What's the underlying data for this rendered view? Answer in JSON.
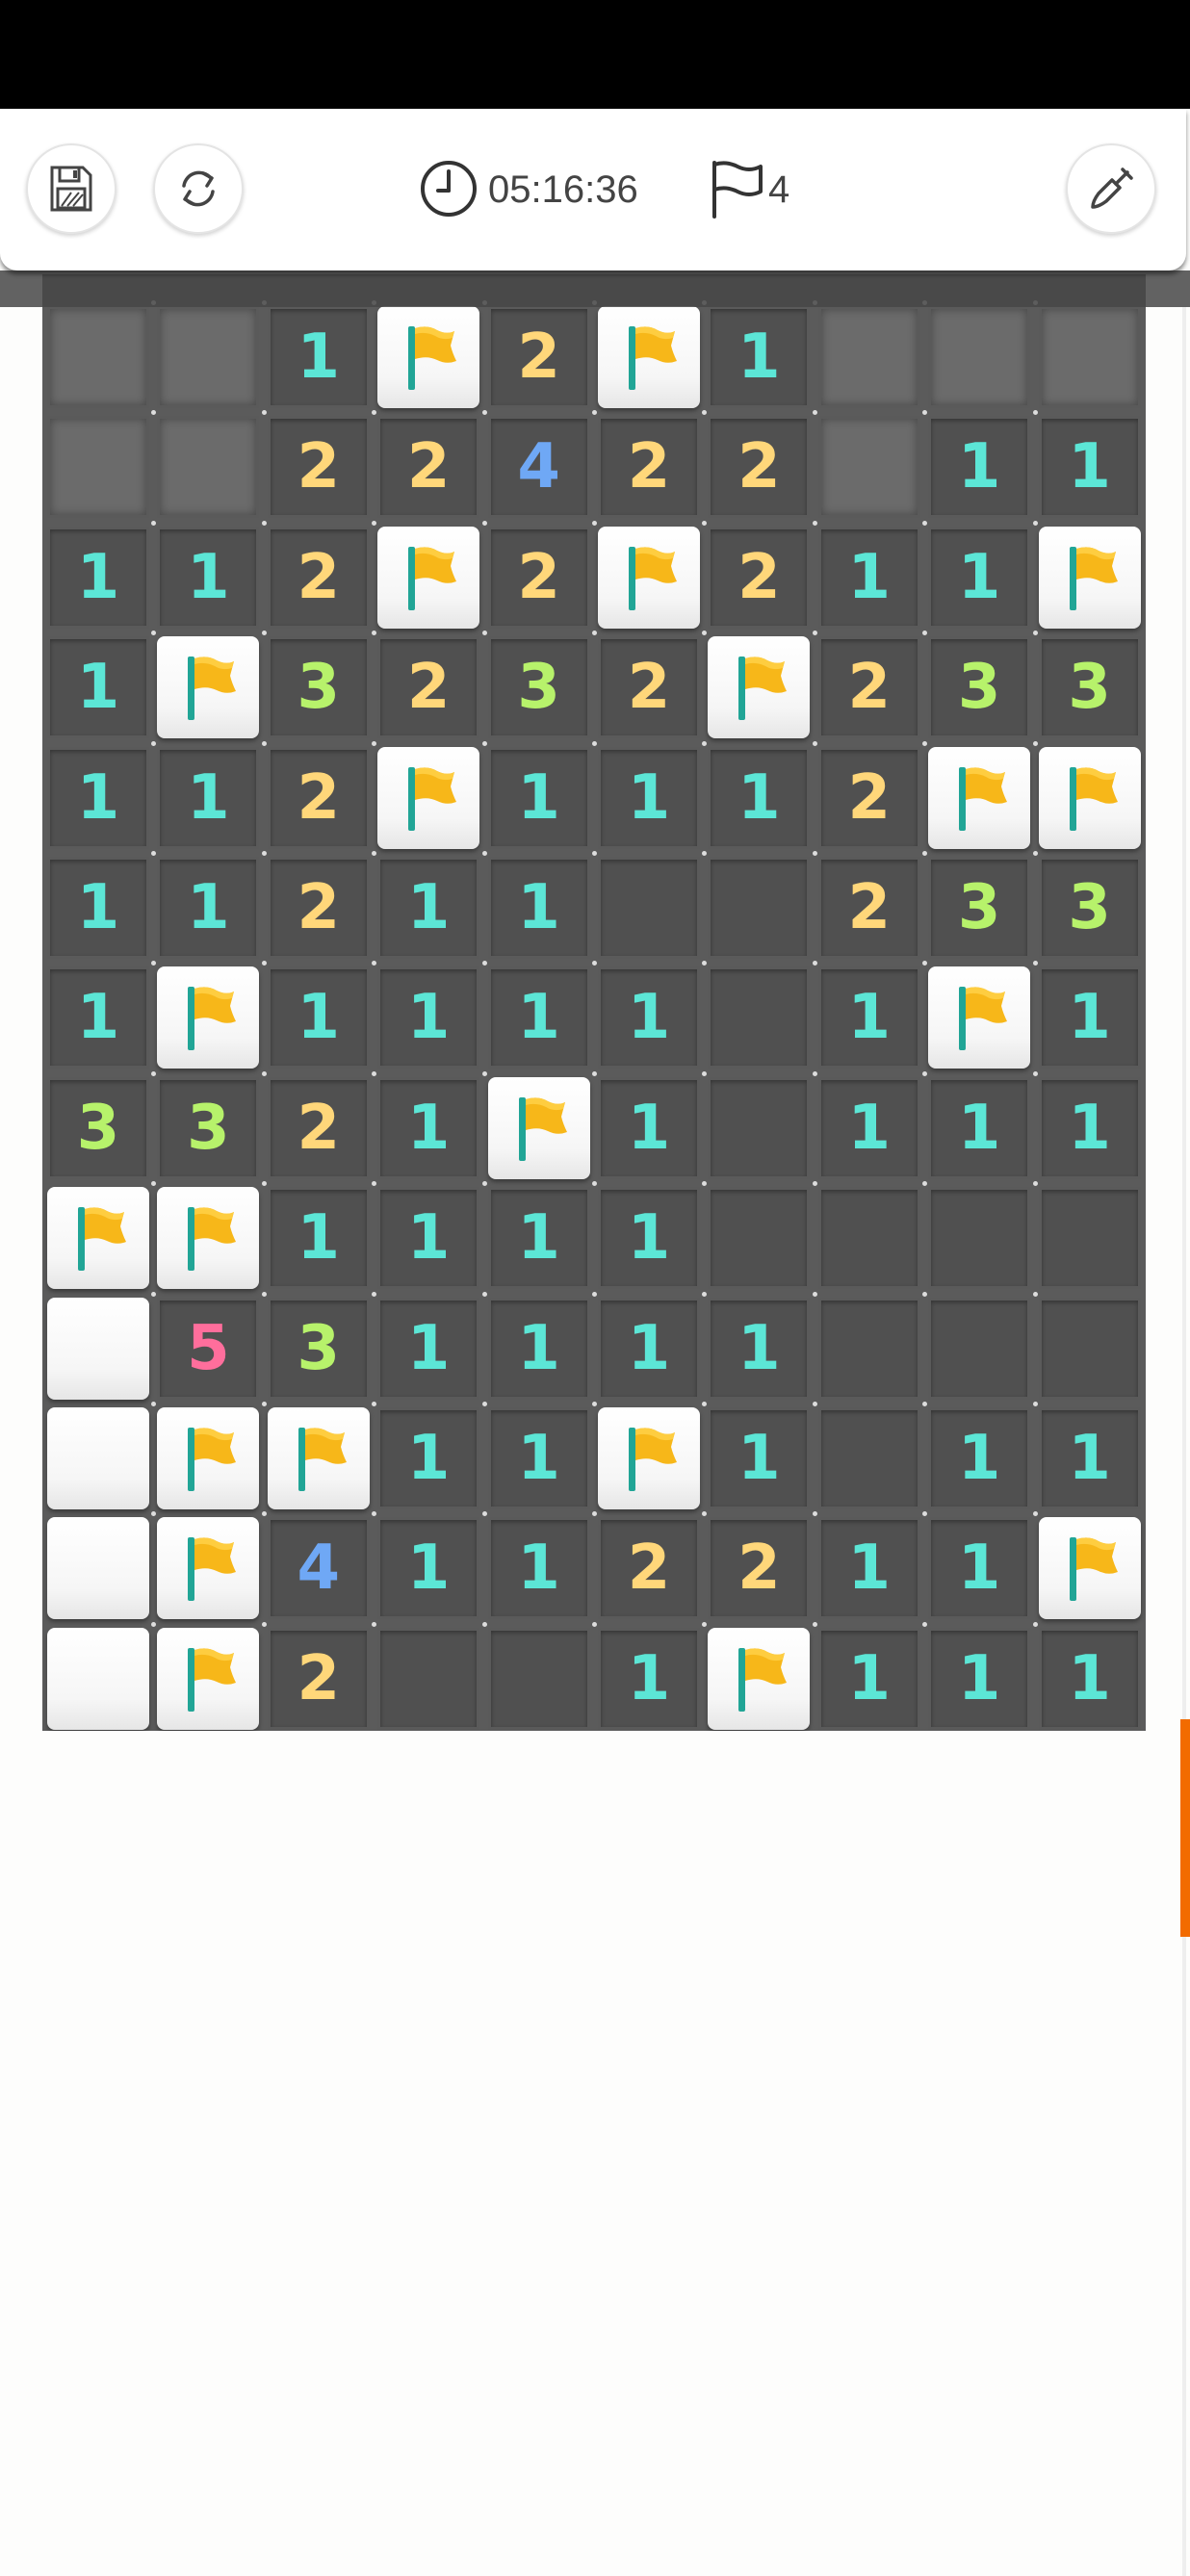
{
  "toolbar": {
    "timer": "05:16:36",
    "flags_remaining": "4",
    "buttons": [
      "save-icon",
      "restart-icon",
      "shovel-icon"
    ]
  },
  "colors": {
    "1": "#5ce6d6",
    "2": "#ffd77a",
    "3": "#b7f26b",
    "4": "#6fa8f5",
    "5": "#ff6e9c",
    "flag": "#f7b719",
    "flag_pole": "#21a596",
    "accent": "#f26b00"
  },
  "board": {
    "rows": [
      [
        "C",
        "C",
        "1",
        "F",
        "2",
        "F",
        "1",
        "C",
        "C",
        "C"
      ],
      [
        "C",
        "C",
        "2",
        "2",
        "4",
        "2",
        "2",
        "C",
        "1",
        "1"
      ],
      [
        "1",
        "1",
        "2",
        "F",
        "2",
        "F",
        "2",
        "1",
        "1",
        "F"
      ],
      [
        "1",
        "F",
        "3",
        "2",
        "3",
        "2",
        "F",
        "2",
        "3",
        "3"
      ],
      [
        "1",
        "1",
        "2",
        "F",
        "1",
        "1",
        "1",
        "2",
        "F",
        "F"
      ],
      [
        "1",
        "1",
        "2",
        "1",
        "1",
        "O",
        "O",
        "2",
        "3",
        "3"
      ],
      [
        "1",
        "F",
        "1",
        "1",
        "1",
        "1",
        "O",
        "1",
        "F",
        "1"
      ],
      [
        "3",
        "3",
        "2",
        "1",
        "F",
        "1",
        "O",
        "1",
        "1",
        "1"
      ],
      [
        "F",
        "F",
        "1",
        "1",
        "1",
        "1",
        "O",
        "O",
        "O",
        "O"
      ],
      [
        "W",
        "5",
        "3",
        "1",
        "1",
        "1",
        "1",
        "O",
        "O",
        "O"
      ],
      [
        "W",
        "F",
        "F",
        "1",
        "1",
        "F",
        "1",
        "O",
        "1",
        "1"
      ],
      [
        "W",
        "F",
        "4",
        "1",
        "1",
        "2",
        "2",
        "1",
        "1",
        "F"
      ],
      [
        "W",
        "F",
        "2",
        "O",
        "O",
        "1",
        "F",
        "1",
        "1",
        "1"
      ]
    ]
  }
}
